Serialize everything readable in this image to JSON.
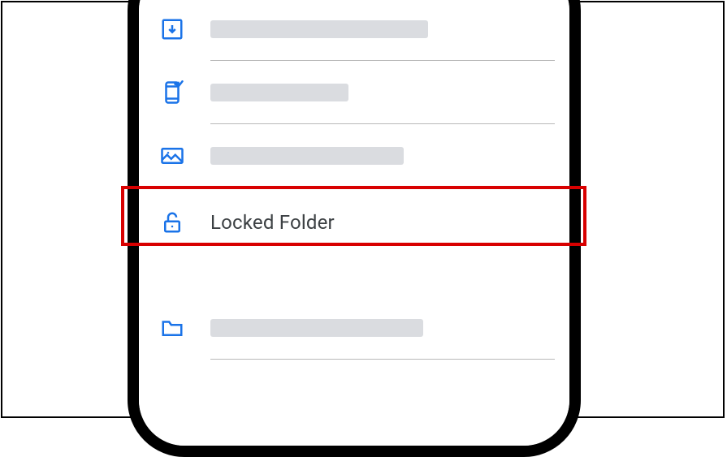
{
  "rows": {
    "archive": {
      "placeholder_w": 268
    },
    "free_up": {
      "placeholder_w": 170
    },
    "photo_frames": {
      "placeholder_w": 238
    },
    "locked": {
      "label": "Locked Folder"
    },
    "section_header": {
      "placeholder_w": 168
    },
    "folder": {
      "placeholder_w": 262
    }
  }
}
